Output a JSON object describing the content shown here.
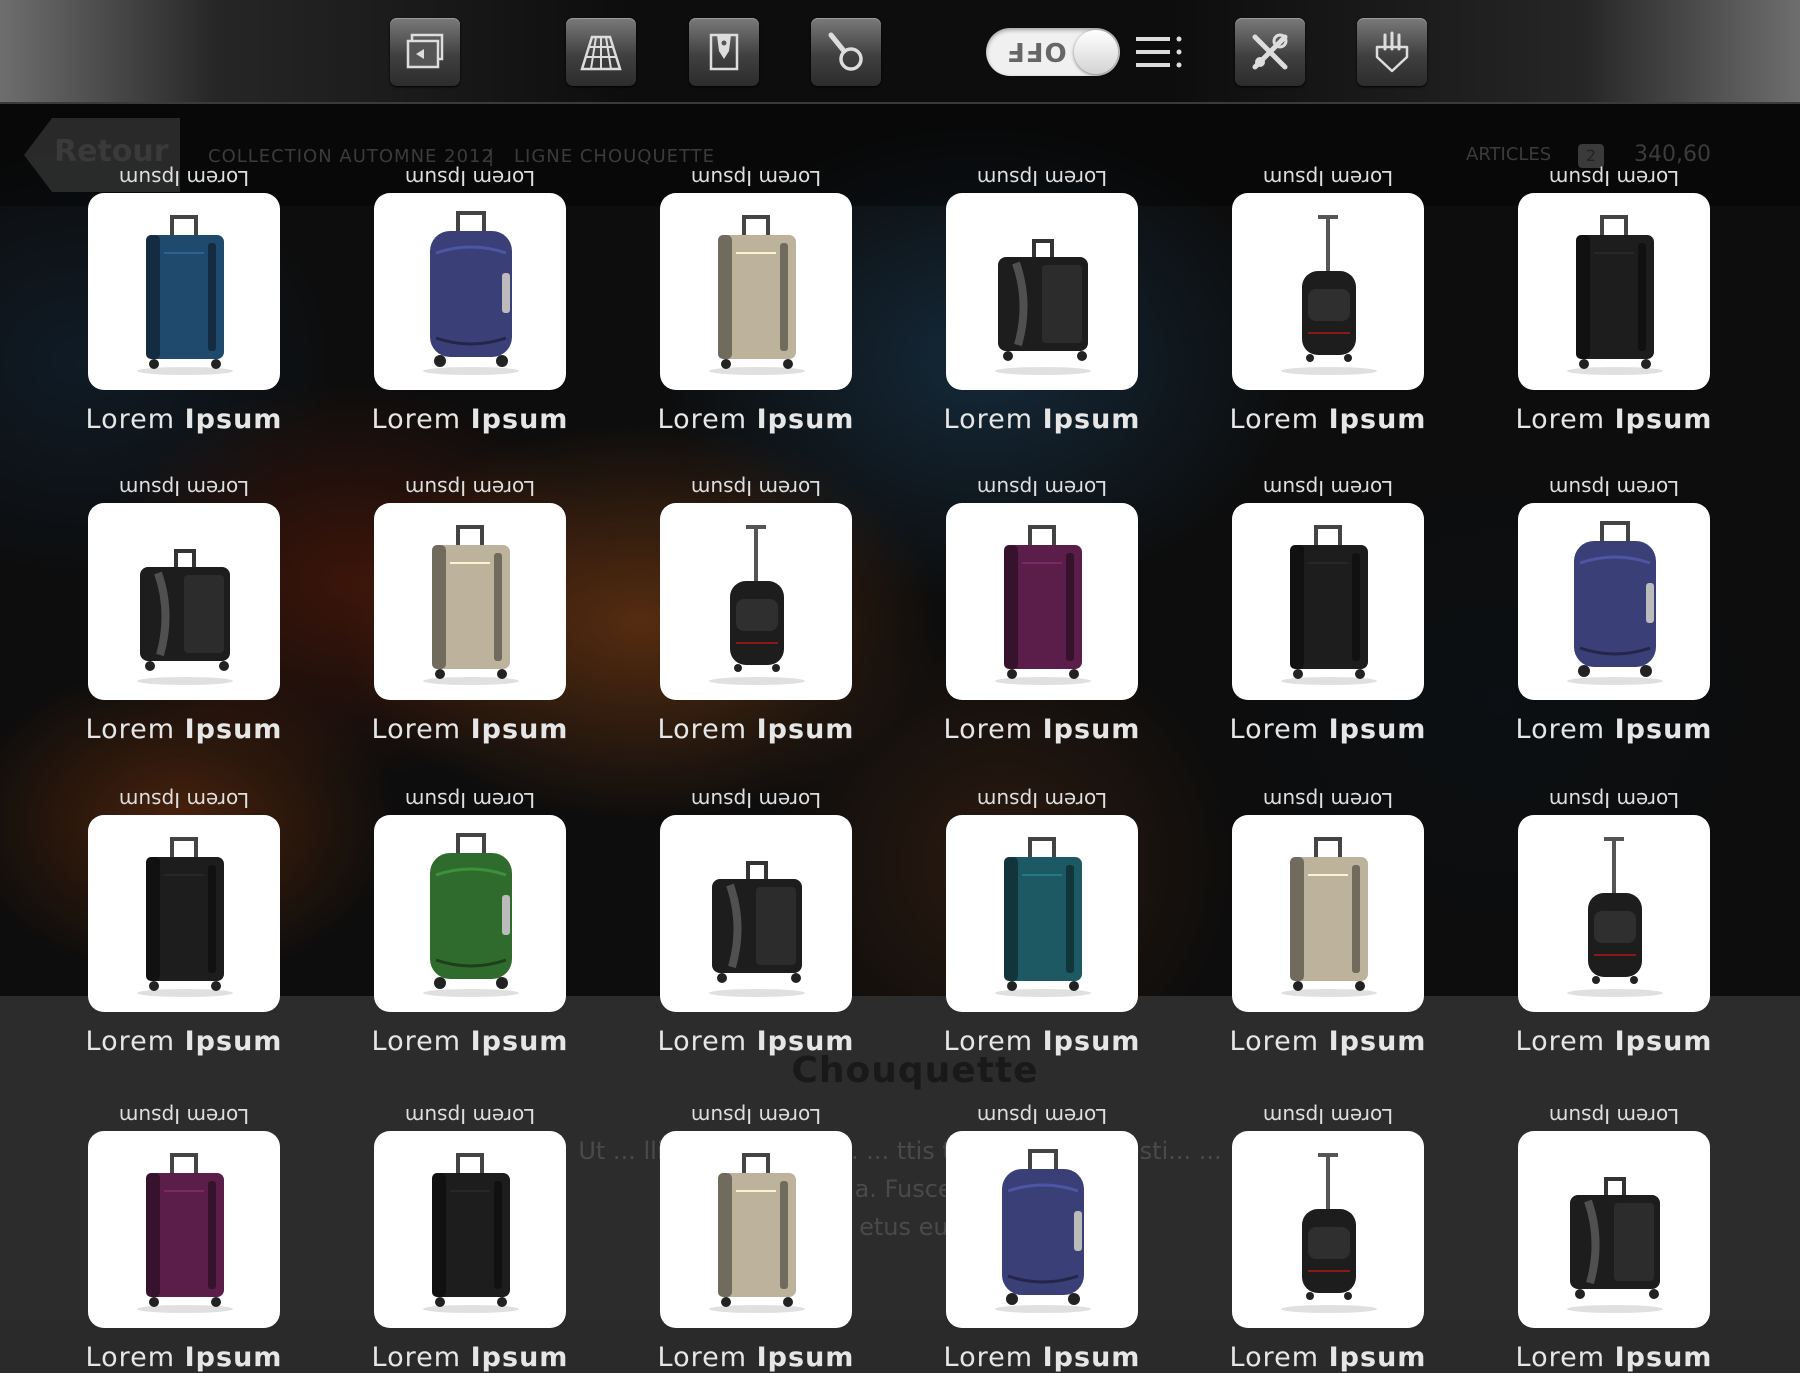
{
  "header": {
    "toolbar_icons": [
      "gallery-icon",
      "perspective-grid-icon",
      "catalog-tag-icon",
      "magnifier-icon",
      "tools-icon",
      "pointing-hand-icon"
    ],
    "toggle": {
      "label": "OFF"
    },
    "menu_icon": "list-menu-icon"
  },
  "subheader": {
    "back_label": "Retour",
    "breadcrumb": [
      "COLLECTION AUTOMNE 2012",
      "|",
      "LIGNE CHOUQUETTE"
    ],
    "articles_label": "ARTICLES",
    "articles_count": "2",
    "total": "340,60"
  },
  "collection": {
    "title": "Chouquette",
    "description": [
      "Ut ... llis ... augue. Eti... ... ttis tellus. ... is molesti... ... ",
      "... et lorem ... a. Fusce ... Nunc et ...",
      "... etus eu..."
    ]
  },
  "colors": {
    "navy": "#1f4a6e",
    "blue": "#3a3f78",
    "beige": "#bdb39c",
    "black": "#1d1d1d",
    "green": "#2f6b2d",
    "purple": "#5b1e4a",
    "teal": "#1c5963"
  },
  "products": [
    {
      "top": "Lorem Ipsum",
      "name1": "Lorem",
      "name2": "Ipsum",
      "kind": "soft",
      "color": "#1f4a6e"
    },
    {
      "top": "Lorem Ipsum",
      "name1": "Lorem",
      "name2": "Ipsum",
      "kind": "hard",
      "color": "#3a3f78"
    },
    {
      "top": "Lorem Ipsum",
      "name1": "Lorem",
      "name2": "Ipsum",
      "kind": "soft",
      "color": "#bdb39c"
    },
    {
      "top": "Lorem Ipsum",
      "name1": "Lorem",
      "name2": "Ipsum",
      "kind": "wide",
      "color": "#1d1d1d"
    },
    {
      "top": "Lorem Ipsum",
      "name1": "Lorem",
      "name2": "Ipsum",
      "kind": "backpack",
      "color": "#1d1d1d"
    },
    {
      "top": "Lorem Ipsum",
      "name1": "Lorem",
      "name2": "Ipsum",
      "kind": "soft",
      "color": "#1d1d1d"
    },
    {
      "top": "Lorem Ipsum",
      "name1": "Lorem",
      "name2": "Ipsum",
      "kind": "wide",
      "color": "#1d1d1d"
    },
    {
      "top": "Lorem Ipsum",
      "name1": "Lorem",
      "name2": "Ipsum",
      "kind": "soft",
      "color": "#bdb39c"
    },
    {
      "top": "Lorem Ipsum",
      "name1": "Lorem",
      "name2": "Ipsum",
      "kind": "backpack",
      "color": "#1d1d1d"
    },
    {
      "top": "Lorem Ipsum",
      "name1": "Lorem",
      "name2": "Ipsum",
      "kind": "soft",
      "color": "#5b1e4a"
    },
    {
      "top": "Lorem Ipsum",
      "name1": "Lorem",
      "name2": "Ipsum",
      "kind": "soft",
      "color": "#1d1d1d"
    },
    {
      "top": "Lorem Ipsum",
      "name1": "Lorem",
      "name2": "Ipsum",
      "kind": "hard",
      "color": "#3a3f78"
    },
    {
      "top": "Lorem Ipsum",
      "name1": "Lorem",
      "name2": "Ipsum",
      "kind": "soft",
      "color": "#1d1d1d"
    },
    {
      "top": "Lorem Ipsum",
      "name1": "Lorem",
      "name2": "Ipsum",
      "kind": "hard",
      "color": "#2f6b2d"
    },
    {
      "top": "Lorem Ipsum",
      "name1": "Lorem",
      "name2": "Ipsum",
      "kind": "wide",
      "color": "#1d1d1d"
    },
    {
      "top": "Lorem Ipsum",
      "name1": "Lorem",
      "name2": "Ipsum",
      "kind": "soft",
      "color": "#1c5963"
    },
    {
      "top": "Lorem Ipsum",
      "name1": "Lorem",
      "name2": "Ipsum",
      "kind": "soft",
      "color": "#bdb39c"
    },
    {
      "top": "Lorem Ipsum",
      "name1": "Lorem",
      "name2": "Ipsum",
      "kind": "backpack",
      "color": "#1d1d1d"
    },
    {
      "top": "Lorem Ipsum",
      "name1": "Lorem",
      "name2": "Ipsum",
      "kind": "soft",
      "color": "#5b1e4a"
    },
    {
      "top": "Lorem Ipsum",
      "name1": "Lorem",
      "name2": "Ipsum",
      "kind": "soft",
      "color": "#1d1d1d"
    },
    {
      "top": "Lorem Ipsum",
      "name1": "Lorem",
      "name2": "Ipsum",
      "kind": "soft",
      "color": "#bdb39c"
    },
    {
      "top": "Lorem Ipsum",
      "name1": "Lorem",
      "name2": "Ipsum",
      "kind": "hard",
      "color": "#3a3f78"
    },
    {
      "top": "Lorem Ipsum",
      "name1": "Lorem",
      "name2": "Ipsum",
      "kind": "backpack",
      "color": "#1d1d1d"
    },
    {
      "top": "Lorem Ipsum",
      "name1": "Lorem",
      "name2": "Ipsum",
      "kind": "wide",
      "color": "#1d1d1d"
    }
  ]
}
